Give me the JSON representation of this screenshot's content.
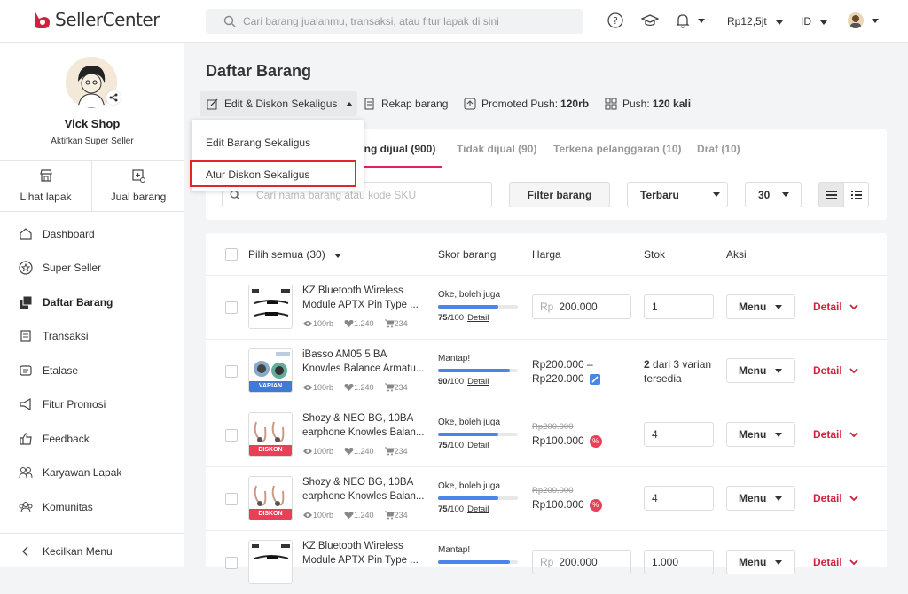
{
  "header": {
    "logo_text": "SellerCenter",
    "search_placeholder": "Cari barang jualanmu, transaksi, atau fitur lapak di sini",
    "saldo": "Rp12,5jt",
    "lang": "ID",
    "brand_color": "#d0213e"
  },
  "sidebar": {
    "shop_name": "Vick Shop",
    "super_seller_link": "Aktifkan Super Seller",
    "quick": [
      {
        "label": "Lihat lapak",
        "icon": "store-icon"
      },
      {
        "label": "Jual barang",
        "icon": "add-product-icon"
      }
    ],
    "items": [
      {
        "label": "Dashboard",
        "icon": "home-icon"
      },
      {
        "label": "Super Seller",
        "icon": "star-icon"
      },
      {
        "label": "Daftar Barang",
        "icon": "list-icon"
      },
      {
        "label": "Transaksi",
        "icon": "receipt-icon"
      },
      {
        "label": "Etalase",
        "icon": "tag-icon"
      },
      {
        "label": "Fitur Promosi",
        "icon": "megaphone-icon"
      },
      {
        "label": "Feedback",
        "icon": "thumbs-up-icon"
      },
      {
        "label": "Karyawan Lapak",
        "icon": "people-icon"
      },
      {
        "label": "Komunitas",
        "icon": "group-icon"
      }
    ],
    "collapse": "Kecilkan Menu"
  },
  "page": {
    "title": "Daftar Barang",
    "toolbar": {
      "edit": "Edit & Diskon Sekaligus",
      "rekap": "Rekap barang",
      "promoted_label": "Promoted Push: ",
      "promoted_value": "120rb",
      "push_label": "Push: ",
      "push_value": "120 kali"
    },
    "dropdown": {
      "item1": "Edit Barang Sekaligus",
      "item2": "Atur Diskon Sekaligus"
    },
    "tabs": {
      "t1": "ang dijual (900)",
      "t2": "Tidak dijual (90)",
      "t3": "Terkena pelanggaran (10)",
      "t4": "Draf (10)"
    },
    "filter": {
      "search_placeholder": "Cari nama barang atau kode SKU",
      "filter_btn": "Filter barang",
      "sort": "Terbaru",
      "per_page": "30"
    },
    "table": {
      "select_all": "Pilih semua (30)",
      "col_skor": "Skor barang",
      "col_harga": "Harga",
      "col_stok": "Stok",
      "col_aksi": "Aksi"
    },
    "rows": [
      {
        "name": "KZ Bluetooth Wireless Module APTX Pin Type ...",
        "views": "100rb",
        "likes": "1.240",
        "sold": "234",
        "skor_label": "Oke, boleh juga",
        "skor": "75",
        "skor_max": "/100",
        "detail_link": "Detail",
        "price_prefix": "Rp",
        "price": "200.000",
        "stock": "1",
        "menu": "Menu",
        "detail": "Detail",
        "score_fill": 0.75
      },
      {
        "name": "iBasso AM05 5 BA Knowles Balance Armatu...",
        "badge": "VARIAN",
        "views": "100rb",
        "likes": "1.240",
        "sold": "234",
        "skor_label": "Mantap!",
        "skor": "90",
        "skor_max": "/100",
        "detail_link": "Detail",
        "price_range": "Rp200.000 –",
        "price_range2": "Rp220.000",
        "stock_num": "2",
        "stock_rest": " dari 3 varian",
        "stock_line2": "tersedia",
        "menu": "Menu",
        "detail": "Detail",
        "score_fill": 0.9
      },
      {
        "name": "Shozy & NEO BG, 10BA earphone Knowles Balan...",
        "badge": "DISKON",
        "views": "100rb",
        "likes": "1.240",
        "sold": "234",
        "skor_label": "Oke, boleh juga",
        "skor": "75",
        "skor_max": "/100",
        "detail_link": "Detail",
        "old_price": "Rp200.000",
        "new_price": "Rp100.000",
        "stock": "4",
        "menu": "Menu",
        "detail": "Detail",
        "score_fill": 0.75
      },
      {
        "name": "Shozy & NEO BG, 10BA earphone Knowles Balan...",
        "badge": "DISKON",
        "views": "100rb",
        "likes": "1.240",
        "sold": "234",
        "skor_label": "Oke, boleh juga",
        "skor": "75",
        "skor_max": "/100",
        "detail_link": "Detail",
        "old_price": "Rp200.000",
        "new_price": "Rp100.000",
        "stock": "4",
        "menu": "Menu",
        "detail": "Detail",
        "score_fill": 0.75
      },
      {
        "name": "KZ Bluetooth Wireless Module APTX Pin Type ...",
        "skor_label": "Mantap!",
        "price_prefix": "Rp",
        "price": "200.000",
        "stock": "1.000",
        "menu": "Menu",
        "detail": "Detail",
        "score_fill": 0.9
      }
    ]
  }
}
